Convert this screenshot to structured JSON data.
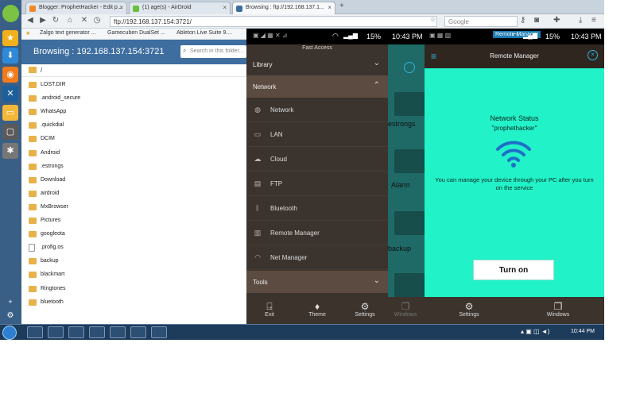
{
  "browser": {
    "tabs": [
      {
        "label": "Blogger: ProphetHacker - Edit p...",
        "color": "#f08a24"
      },
      {
        "label": "(1) age(s) - AirDroid",
        "color": "#6bbf3a"
      },
      {
        "label": "Browsing : ftp://192.168.137.1...",
        "color": "#3e6ea0"
      }
    ],
    "new_tab": "+",
    "url": "ftp://192.168.137.154:3721/",
    "search_placeholder": "Google",
    "bookmarks": [
      "Zalgo text generator ...",
      "Gamecuben DualSet ...",
      "Ableton Live Suite 9...."
    ]
  },
  "file_browser": {
    "title": "Browsing : 192.168.137.154:3721",
    "search_placeholder": "Search in this folder...",
    "path": "/",
    "files": [
      {
        "name": "LOST.DIR",
        "type": "folder"
      },
      {
        "name": ".android_secure",
        "type": "folder"
      },
      {
        "name": "WhatsApp",
        "type": "folder"
      },
      {
        "name": ".quickdial",
        "type": "folder"
      },
      {
        "name": "DCIM",
        "type": "folder"
      },
      {
        "name": "Android",
        "type": "folder"
      },
      {
        "name": ".estrongs",
        "type": "folder"
      },
      {
        "name": "Download",
        "type": "folder"
      },
      {
        "name": "airdroid",
        "type": "folder"
      },
      {
        "name": "MxBrowser",
        "type": "folder"
      },
      {
        "name": "Pictures",
        "type": "folder"
      },
      {
        "name": "googleota",
        "type": "folder"
      },
      {
        "name": ".profig.os",
        "type": "file"
      },
      {
        "name": "backup",
        "type": "folder"
      },
      {
        "name": "blackmart",
        "type": "folder"
      },
      {
        "name": "Ringtones",
        "type": "folder"
      },
      {
        "name": "bluetooth",
        "type": "folder"
      }
    ]
  },
  "phone_status": {
    "battery": "15%",
    "time": "10:43 PM"
  },
  "drawer": {
    "title": "Fast Access",
    "sections": {
      "library": "Library",
      "network": "Network",
      "tools": "Tools"
    },
    "items": [
      {
        "label": "Network",
        "icon": "globe-icon"
      },
      {
        "label": "LAN",
        "icon": "monitor-icon"
      },
      {
        "label": "Cloud",
        "icon": "cloud-icon"
      },
      {
        "label": "FTP",
        "icon": "ftp-icon"
      },
      {
        "label": "Bluetooth",
        "icon": "bluetooth-icon"
      },
      {
        "label": "Remote Manager",
        "icon": "remote-icon"
      },
      {
        "label": "Net Manager",
        "icon": "wifi-icon"
      }
    ],
    "bottom": {
      "exit": "Exit",
      "theme": "Theme",
      "settings": "Settings",
      "windows": "Windows"
    }
  },
  "background_labels": [
    "estrongs",
    "Alarm",
    "backup"
  ],
  "remote_manager": {
    "notification": "Remote Manager",
    "title": "Remote Manager",
    "status_title": "Network Status",
    "username": "\"prophethacker\"",
    "message": "You can manage your device through your PC after you turn on the service",
    "button": "Turn on",
    "bottom": {
      "settings": "Settings",
      "windows": "Windows"
    }
  },
  "taskbar": {
    "time": "10:44 PM"
  },
  "colors": {
    "accent_teal": "#22f2c8",
    "header_blue": "#3e6ea0",
    "drawer_brown": "#3b332d"
  }
}
